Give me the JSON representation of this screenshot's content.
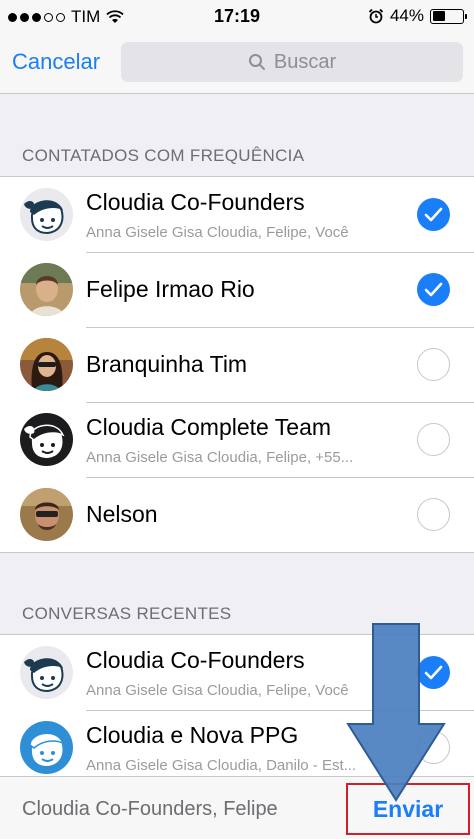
{
  "status_bar": {
    "carrier": "TIM",
    "time": "17:19",
    "battery": "44%",
    "battery_level": 0.44
  },
  "nav": {
    "cancel": "Cancelar",
    "search_placeholder": "Buscar"
  },
  "frequent": {
    "header": "CONTATADOS COM FREQUÊNCIA",
    "items": [
      {
        "name": "Cloudia Co-Founders",
        "subtitle": "Anna Gisele Gisa Cloudia, Felipe, Você",
        "checked": true,
        "avatar": "cloudia-logo"
      },
      {
        "name": "Felipe Irmao Rio",
        "subtitle": "",
        "checked": true,
        "avatar": "photo"
      },
      {
        "name": "Branquinha Tim",
        "subtitle": "",
        "checked": false,
        "avatar": "photo"
      },
      {
        "name": "Cloudia Complete Team",
        "subtitle": "Anna Gisele Gisa Cloudia, Felipe, +55...",
        "checked": false,
        "avatar": "cloudia-logo-dark"
      },
      {
        "name": "Nelson",
        "subtitle": "",
        "checked": false,
        "avatar": "photo"
      }
    ]
  },
  "recent": {
    "header": "CONVERSAS RECENTES",
    "items": [
      {
        "name": "Cloudia Co-Founders",
        "subtitle": "Anna Gisele Gisa Cloudia, Felipe, Você",
        "checked": true,
        "avatar": "cloudia-logo"
      },
      {
        "name": "Cloudia e Nova PPG",
        "subtitle": "Anna Gisele Gisa Cloudia, Danilo - Est...",
        "checked": false,
        "avatar": "cloudia-logo-blue"
      }
    ]
  },
  "bottom": {
    "selected": "Cloudia Co-Founders, Felipe",
    "send": "Enviar"
  },
  "colors": {
    "accent": "#1a7ef8",
    "annotation_box": "#d21f2b",
    "annotation_arrow": "#4a7fc0"
  }
}
